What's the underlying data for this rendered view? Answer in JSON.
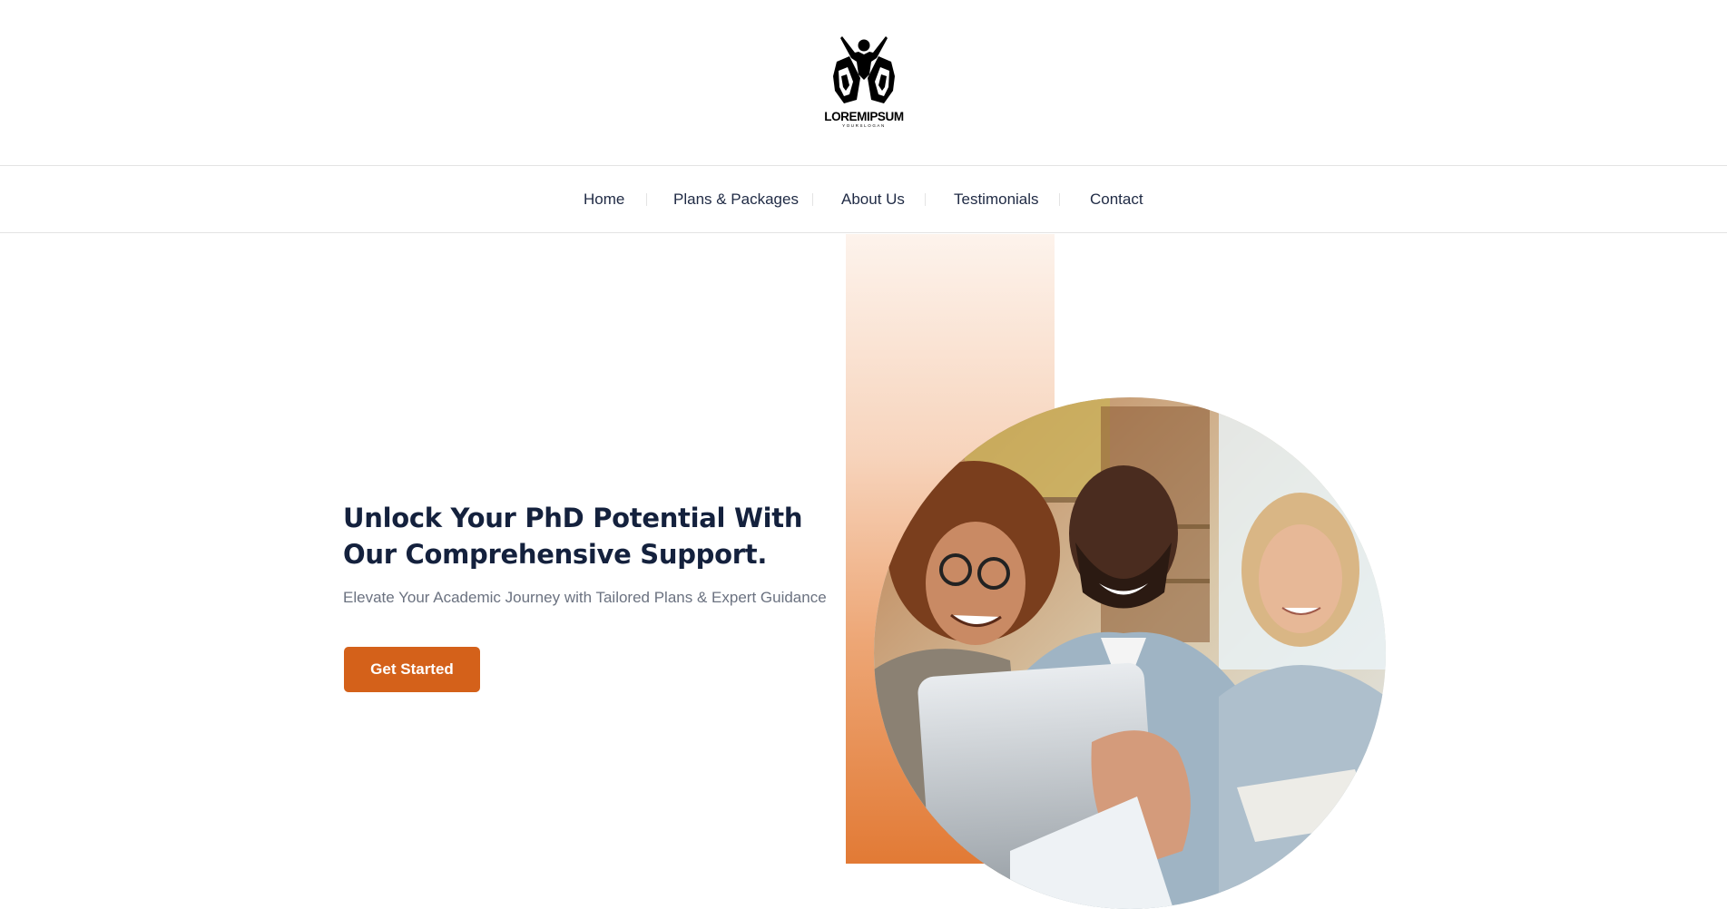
{
  "logo": {
    "brand": "LOREMIPSUM",
    "slogan": "YOURSLOGAN",
    "icon": "people-raising-hands-icon"
  },
  "nav": {
    "items": [
      {
        "label": "Home"
      },
      {
        "label": "Plans & Packages"
      },
      {
        "label": "About Us"
      },
      {
        "label": "Testimonials"
      },
      {
        "label": "Contact"
      }
    ]
  },
  "hero": {
    "title": "Unlock Your PhD Potential With Our Comprehensive Support.",
    "subtitle": "Elevate Your Academic Journey with Tailored Plans & Expert Guidance",
    "cta_label": "Get Started",
    "image_icon": "students-photo"
  },
  "colors": {
    "accent": "#d4611a",
    "heading": "#14213d",
    "muted": "#6b7280"
  }
}
